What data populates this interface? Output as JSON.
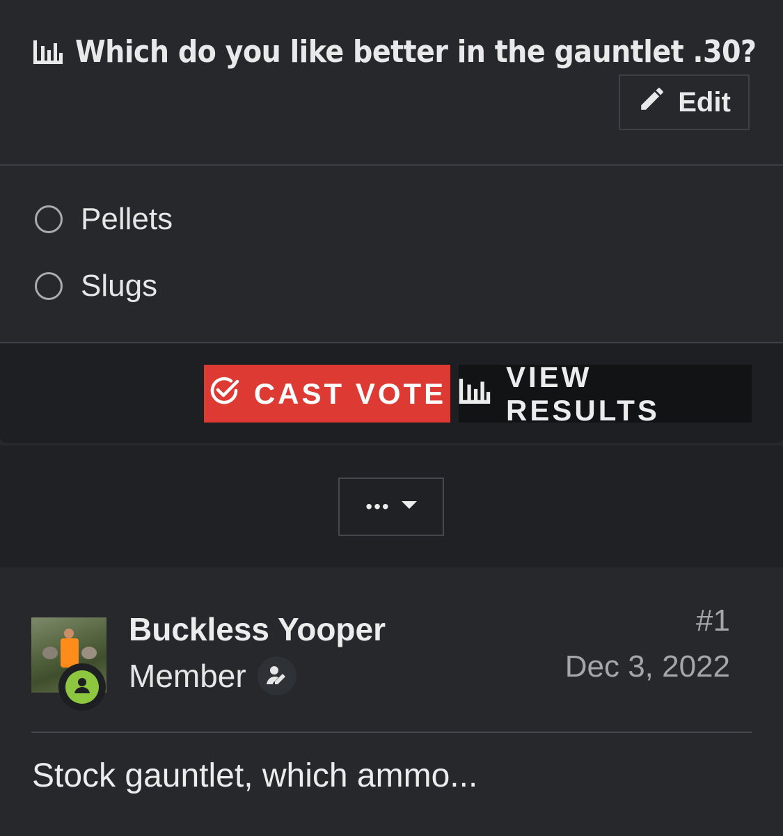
{
  "poll": {
    "title": "Which do you like better in the gauntlet .30?",
    "edit_label": "Edit",
    "options": [
      {
        "label": "Pellets"
      },
      {
        "label": "Slugs"
      }
    ],
    "cast_vote_label": "CAST VOTE",
    "view_results_label": "VIEW RESULTS"
  },
  "menu": {
    "more_label": "•••"
  },
  "post": {
    "username": "Buckless Yooper",
    "role": "Member",
    "number": "#1",
    "date": "Dec 3, 2022",
    "text": "Stock gauntlet, which ammo..."
  },
  "colors": {
    "background": "#26282c",
    "cast_vote": "#dc3a33",
    "view_results": "#121314",
    "online_status": "#8dc63f"
  },
  "icons": {
    "title": "poll-chart-icon",
    "edit": "pencil-icon",
    "cast_vote": "check-circle-icon",
    "view_results": "poll-chart-icon",
    "more": "caret-down-icon",
    "status": "user-online-icon",
    "role": "user-edit-icon"
  }
}
